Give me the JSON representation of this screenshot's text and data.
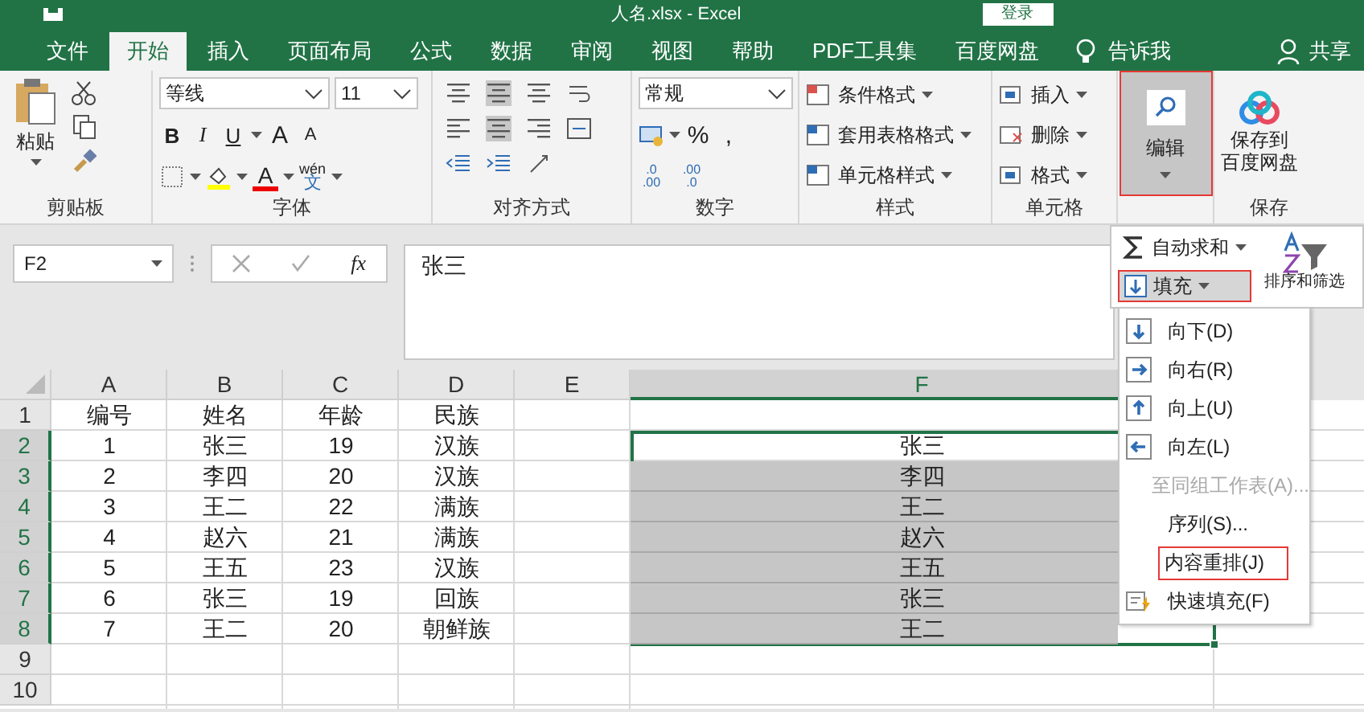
{
  "window": {
    "title": "人名.xlsx  -  Excel",
    "login_button": "登录"
  },
  "tabs": [
    {
      "label": "文件",
      "selected": false
    },
    {
      "label": "开始",
      "selected": true
    },
    {
      "label": "插入",
      "selected": false
    },
    {
      "label": "页面布局",
      "selected": false
    },
    {
      "label": "公式",
      "selected": false
    },
    {
      "label": "数据",
      "selected": false
    },
    {
      "label": "审阅",
      "selected": false
    },
    {
      "label": "视图",
      "selected": false
    },
    {
      "label": "帮助",
      "selected": false
    },
    {
      "label": "PDF工具集",
      "selected": false
    },
    {
      "label": "百度网盘",
      "selected": false
    }
  ],
  "tell_me": "告诉我",
  "share": "共享",
  "ribbon": {
    "clipboard": {
      "label": "剪贴板",
      "paste": "粘贴"
    },
    "font": {
      "label": "字体",
      "font_name": "等线",
      "font_size": "11",
      "bold": "B",
      "italic": "I",
      "underline": "U",
      "grow": "A",
      "shrink": "A",
      "font_color": "A",
      "phonetic": "wén",
      "phonetic_char": "文"
    },
    "alignment": {
      "label": "对齐方式"
    },
    "number": {
      "label": "数字",
      "format": "常规",
      "percent": "%",
      "comma": ",",
      "increase_decimal": [
        ".0",
        ".00"
      ],
      "decrease_decimal": [
        ".00",
        ".0"
      ]
    },
    "styles": {
      "label": "样式",
      "items": [
        "条件格式",
        "套用表格格式",
        "单元格样式"
      ]
    },
    "cells": {
      "label": "单元格",
      "items": [
        "插入",
        "删除",
        "格式"
      ]
    },
    "editing": {
      "label": "编辑",
      "selected": true
    },
    "save": {
      "label": "保存",
      "button": [
        "保存到",
        "百度网盘"
      ]
    }
  },
  "formula_bar": {
    "name_box": "F2",
    "fx": "fx",
    "value": "张三"
  },
  "editing_menu": {
    "autosum": "自动求和",
    "fill": {
      "label": "填充",
      "selected": true
    },
    "sort": "排序和筛选",
    "fill_items": [
      {
        "label": "向下(D)",
        "kind": "down",
        "disabled": false,
        "selected": false
      },
      {
        "label": "向右(R)",
        "kind": "right",
        "disabled": false,
        "selected": false
      },
      {
        "label": "向上(U)",
        "kind": "up",
        "disabled": false,
        "selected": false
      },
      {
        "label": "向左(L)",
        "kind": "left",
        "disabled": false,
        "selected": false
      },
      {
        "label": "至同组工作表(A)...",
        "kind": "plain",
        "disabled": true,
        "selected": false
      },
      {
        "label": "序列(S)...",
        "kind": "plain",
        "disabled": false,
        "selected": false
      },
      {
        "label": "内容重排(J)",
        "kind": "plain",
        "disabled": false,
        "selected": true
      },
      {
        "label": "快速填充(F)",
        "kind": "flash",
        "disabled": false,
        "selected": false
      }
    ]
  },
  "sheet": {
    "columns": [
      {
        "label": "A",
        "selected": false
      },
      {
        "label": "B",
        "selected": false
      },
      {
        "label": "C",
        "selected": false
      },
      {
        "label": "D",
        "selected": false
      },
      {
        "label": "E",
        "selected": false
      },
      {
        "label": "F",
        "selected": true
      }
    ],
    "rows": [
      {
        "header": "1",
        "selected": false,
        "cells": [
          "编号",
          "姓名",
          "年龄",
          "民族"
        ]
      },
      {
        "header": "2",
        "selected": true,
        "cells": [
          "1",
          "张三",
          "19",
          "汉族"
        ],
        "f": {
          "text": "张三",
          "active": true
        }
      },
      {
        "header": "3",
        "selected": true,
        "cells": [
          "2",
          "李四",
          "20",
          "汉族"
        ],
        "f": {
          "text": "李四",
          "active": false
        }
      },
      {
        "header": "4",
        "selected": true,
        "cells": [
          "3",
          "王二",
          "22",
          "满族"
        ],
        "f": {
          "text": "王二",
          "active": false
        }
      },
      {
        "header": "5",
        "selected": true,
        "cells": [
          "4",
          "赵六",
          "21",
          "满族"
        ],
        "f": {
          "text": "赵六",
          "active": false
        }
      },
      {
        "header": "6",
        "selected": true,
        "cells": [
          "5",
          "王五",
          "23",
          "汉族"
        ],
        "f": {
          "text": "王五",
          "active": false
        }
      },
      {
        "header": "7",
        "selected": true,
        "cells": [
          "6",
          "张三",
          "19",
          "回族"
        ],
        "f": {
          "text": "张三",
          "active": false
        }
      },
      {
        "header": "8",
        "selected": true,
        "cells": [
          "7",
          "王二",
          "20",
          "朝鲜族"
        ],
        "f": {
          "text": "王二",
          "active": false
        }
      },
      {
        "header": "9",
        "selected": false,
        "cells": []
      },
      {
        "header": "10",
        "selected": false,
        "cells": []
      }
    ]
  }
}
